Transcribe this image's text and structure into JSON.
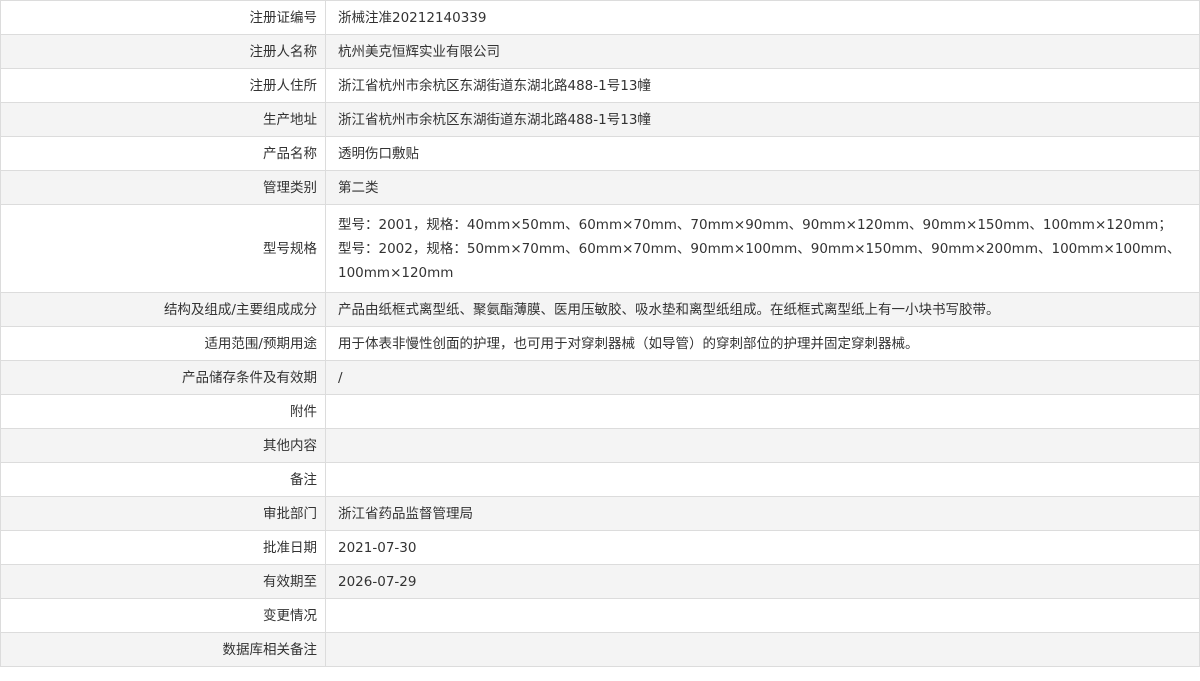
{
  "rows": [
    {
      "label": "注册证编号",
      "value": "浙械注准20212140339"
    },
    {
      "label": "注册人名称",
      "value": "杭州美克恒辉实业有限公司"
    },
    {
      "label": "注册人住所",
      "value": "浙江省杭州市余杭区东湖街道东湖北路488-1号13幢"
    },
    {
      "label": "生产地址",
      "value": "浙江省杭州市余杭区东湖街道东湖北路488-1号13幢"
    },
    {
      "label": "产品名称",
      "value": "透明伤口敷贴"
    },
    {
      "label": "管理类别",
      "value": "第二类"
    },
    {
      "label": "型号规格",
      "value": "型号：2001，规格：40mm×50mm、60mm×70mm、70mm×90mm、90mm×120mm、90mm×150mm、100mm×120mm；型号：2002，规格：50mm×70mm、60mm×70mm、90mm×100mm、90mm×150mm、90mm×200mm、100mm×100mm、100mm×120mm"
    },
    {
      "label": "结构及组成/主要组成成分",
      "value": "产品由纸框式离型纸、聚氨酯薄膜、医用压敏胶、吸水垫和离型纸组成。在纸框式离型纸上有一小块书写胶带。"
    },
    {
      "label": "适用范围/预期用途",
      "value": "用于体表非慢性创面的护理，也可用于对穿刺器械（如导管）的穿刺部位的护理并固定穿刺器械。"
    },
    {
      "label": "产品储存条件及有效期",
      "value": "/"
    },
    {
      "label": "附件",
      "value": ""
    },
    {
      "label": "其他内容",
      "value": ""
    },
    {
      "label": "备注",
      "value": ""
    },
    {
      "label": "审批部门",
      "value": "浙江省药品监督管理局"
    },
    {
      "label": "批准日期",
      "value": "2021-07-30"
    },
    {
      "label": "有效期至",
      "value": "2026-07-29"
    },
    {
      "label": "变更情况",
      "value": ""
    },
    {
      "label": "数据库相关备注",
      "value": ""
    }
  ]
}
